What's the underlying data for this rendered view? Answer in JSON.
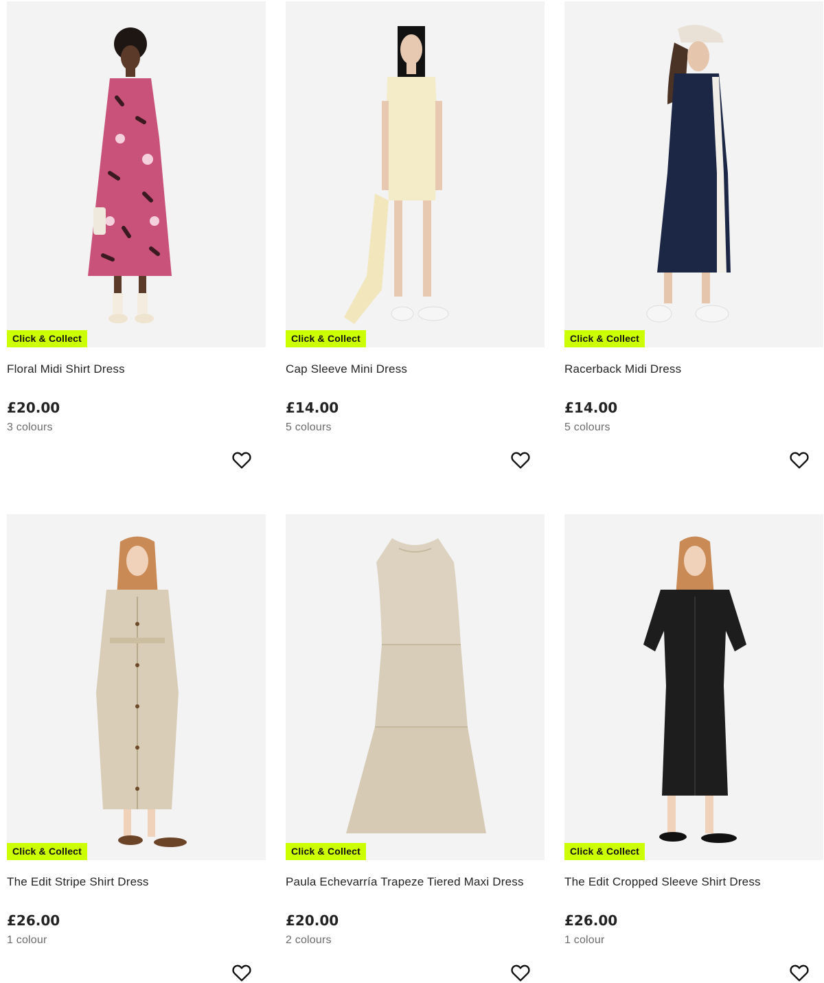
{
  "badge_label": "Click & Collect",
  "colors": {
    "badge_bg": "#ccff00",
    "image_bg": "#f3f3f4",
    "price_text": "#222222",
    "muted_text": "#6b6b6b"
  },
  "products": [
    {
      "title": "Floral Midi Shirt Dress",
      "price": "£20.00",
      "colours": "3 colours",
      "image": "model-floral-pink-dress"
    },
    {
      "title": "Cap Sleeve Mini Dress",
      "price": "£14.00",
      "colours": "5 colours",
      "image": "model-cream-mini-dress"
    },
    {
      "title": "Racerback Midi Dress",
      "price": "£14.00",
      "colours": "5 colours",
      "image": "model-navy-racerback-dress"
    },
    {
      "title": "The Edit Stripe Shirt Dress",
      "price": "£26.00",
      "colours": "1 colour",
      "image": "model-beige-shirt-dress"
    },
    {
      "title": "Paula Echevarría Trapeze Tiered Maxi Dress",
      "price": "£20.00",
      "colours": "2 colours",
      "image": "flatlay-beige-tiered-dress"
    },
    {
      "title": "The Edit Cropped Sleeve Shirt Dress",
      "price": "£26.00",
      "colours": "1 colour",
      "image": "model-black-shirt-dress"
    }
  ],
  "icons": {
    "wishlist": "heart-outline-icon"
  }
}
